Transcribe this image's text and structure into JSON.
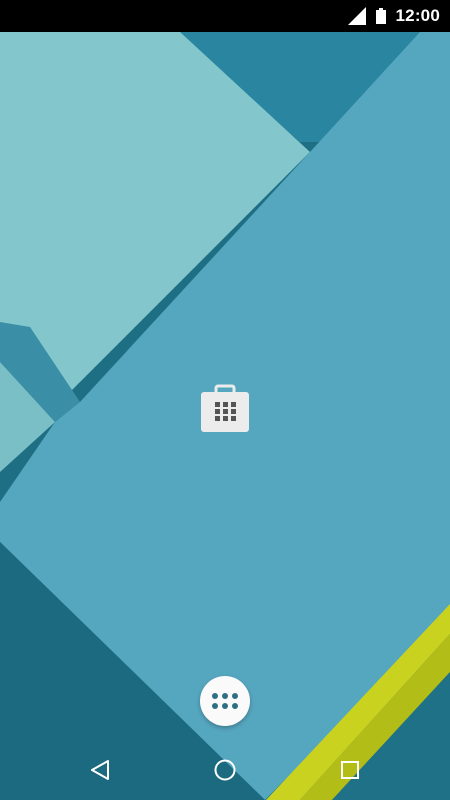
{
  "status_bar": {
    "time": "12:00",
    "icons": [
      "signal-icon",
      "battery-icon"
    ],
    "background": "#000000"
  },
  "home_screen": {
    "wallpaper_colors": {
      "base": "#1f6f84",
      "light_teal": "#80c7cc",
      "mid_blue": "#56a8c2",
      "dark_blue": "#2d87a3",
      "accent_yellow": "#c9d21e"
    },
    "app_icons": [
      "store-icon"
    ],
    "app_drawer_icon": "app-drawer-icon"
  },
  "navigation_bar": {
    "buttons": [
      "back-icon",
      "home-icon",
      "recents-icon"
    ]
  }
}
